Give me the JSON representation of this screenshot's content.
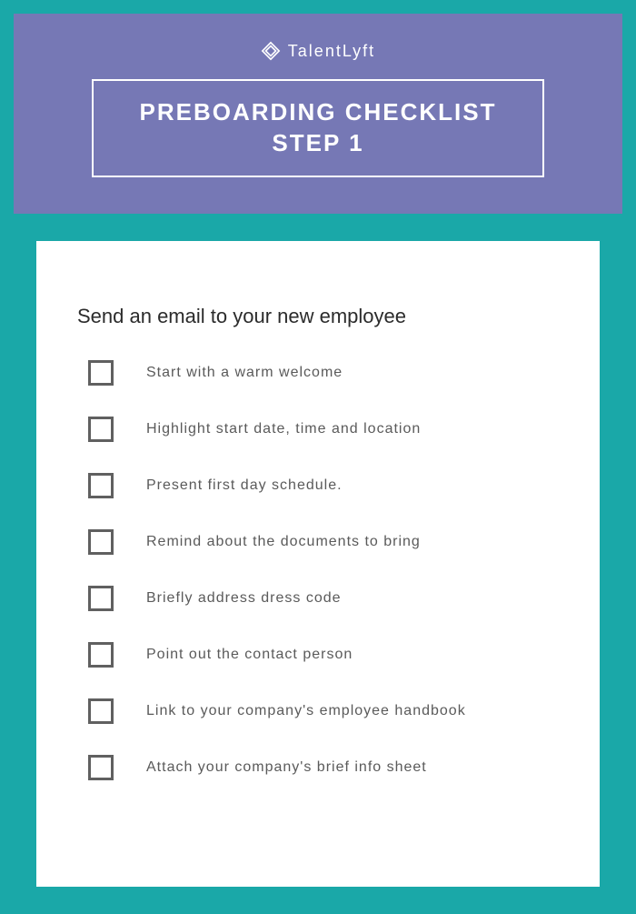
{
  "brand": {
    "name": "TalentLyft"
  },
  "header": {
    "title_line1": "PREBOARDING CHECKLIST",
    "title_line2": "STEP 1"
  },
  "section": {
    "title": "Send an email to your new employee"
  },
  "checklist": [
    {
      "label": "Start with a warm welcome"
    },
    {
      "label": "Highlight start date, time and location"
    },
    {
      "label": "Present first day schedule."
    },
    {
      "label": "Remind about the documents to bring"
    },
    {
      "label": "Briefly address dress code"
    },
    {
      "label": "Point out the contact person"
    },
    {
      "label": "Link to your company's employee handbook"
    },
    {
      "label": "Attach your company's brief info sheet"
    }
  ]
}
